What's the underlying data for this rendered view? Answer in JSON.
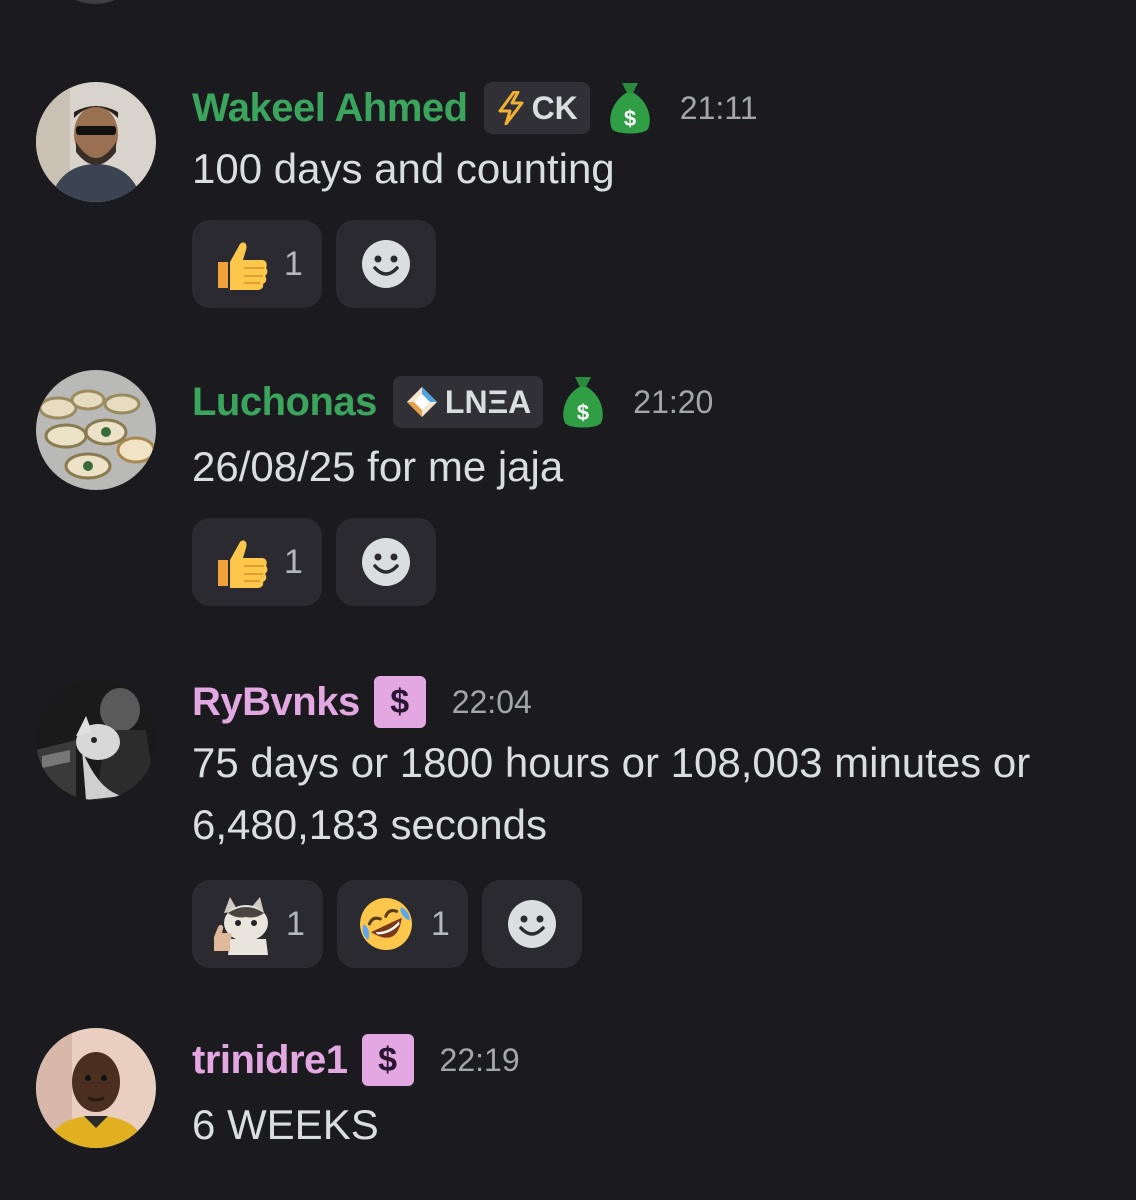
{
  "messages": [
    {
      "username": "Wakeel Ahmed",
      "username_color": "#3ba55d",
      "tag": {
        "icon": "lightning-icon",
        "text": "CK"
      },
      "badge": "money-bag-icon",
      "time": "21:11",
      "text": "100 days and counting",
      "reactions": [
        {
          "emoji": "thumbs-up-icon",
          "count": "1"
        }
      ]
    },
    {
      "username": "Luchonas",
      "username_color": "#3ba55d",
      "tag": {
        "icon": "diamond-icon",
        "text": "LNΞA"
      },
      "badge": "money-bag-icon",
      "time": "21:20",
      "text": "26/08/25 for me jaja",
      "reactions": [
        {
          "emoji": "thumbs-up-icon",
          "count": "1"
        }
      ]
    },
    {
      "username": "RyBvnks",
      "username_color": "#e3a8e2",
      "badge_text": "$",
      "time": "22:04",
      "text": "75 days or 1800 hours or 108,003 minutes or 6,480,183 seconds",
      "reactions": [
        {
          "emoji": "cat-thumbs-up-icon",
          "count": "1"
        },
        {
          "emoji": "rofl-icon",
          "count": "1"
        }
      ]
    },
    {
      "username": "trinidre1",
      "username_color": "#e3a8e2",
      "badge_text": "$",
      "time": "22:19",
      "text": "6 WEEKS"
    }
  ]
}
